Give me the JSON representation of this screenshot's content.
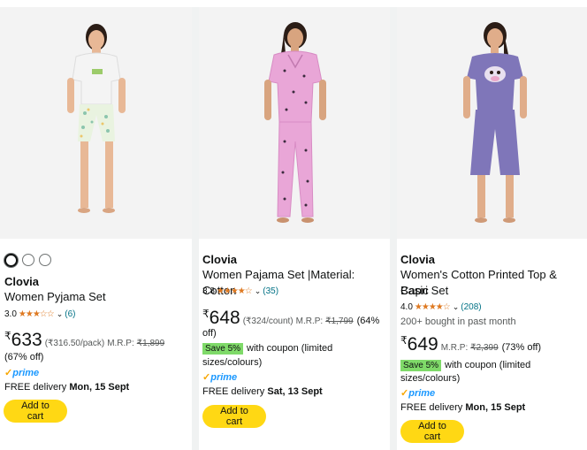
{
  "products": [
    {
      "brand": "Clovia",
      "title": "Women Pyjama Set",
      "rating_value": "3.0",
      "stars": "★★★☆☆",
      "review_count": "(6)",
      "currency": "₹",
      "price": "633",
      "unit_price": "(₹316.50/pack)",
      "mrp_label": "M.R.P:",
      "mrp": "₹1,899",
      "discount": "(67% off)",
      "prime": "prime",
      "delivery_prefix": "FREE delivery",
      "delivery_date": "Mon, 15 Sept",
      "add_to_cart": "Add to cart"
    },
    {
      "brand": "Clovia",
      "title": "Women Pajama Set |Material: Cotton",
      "rating_value": "3.8",
      "stars": "★★★★☆",
      "review_count": "(35)",
      "currency": "₹",
      "price": "648",
      "unit_price": "(₹324/count)",
      "mrp_label": "M.R.P:",
      "mrp": "₹1,799",
      "discount": "(64%",
      "discount2": "off)",
      "coupon_badge": "Save 5%",
      "coupon_text": "with coupon (limited",
      "coupon_text2": "sizes/colours)",
      "prime": "prime",
      "delivery_prefix": "FREE delivery",
      "delivery_date": "Sat, 13 Sept",
      "add_to_cart": "Add to cart"
    },
    {
      "brand": "Clovia",
      "title": "Women's Cotton Printed Top & Basic",
      "title2": "Capri Set",
      "rating_value": "4.0",
      "stars": "★★★★☆",
      "review_count": "(208)",
      "bought": "200+ bought in past month",
      "currency": "₹",
      "price": "649",
      "mrp_label": "M.R.P:",
      "mrp": "₹2,399",
      "discount": "(73% off)",
      "coupon_badge": "Save 5%",
      "coupon_text": "with coupon (limited",
      "coupon_text2": "sizes/colours)",
      "prime": "prime",
      "delivery_prefix": "FREE delivery",
      "delivery_date": "Mon, 15 Sept",
      "add_to_cart": "Add to cart"
    }
  ],
  "colors": {
    "accent_button": "#ffd814",
    "star": "#de7921",
    "link": "#007185",
    "prime": "#1a98ff",
    "coupon": "#7fda69"
  }
}
